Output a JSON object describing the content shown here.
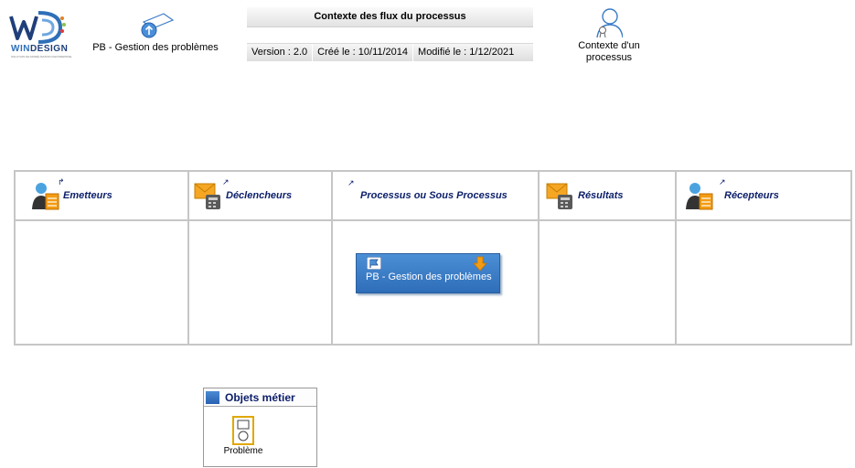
{
  "logo": {
    "brand_win": "WIN",
    "brand_design": "DESIGN",
    "tagline": "SOLUTION DE MODÉLISATION D'ENTREPRISE"
  },
  "parent": {
    "label": "PB - Gestion des problèmes",
    "icon": "process-up-icon"
  },
  "header": {
    "title": "Contexte des flux du processus",
    "version": "Version : 2.0",
    "created": "Créé le : 10/11/2014",
    "modified": "Modifié le : 1/12/2021"
  },
  "context": {
    "label_line1": "Contexte d'un",
    "label_line2": "processus",
    "icon": "person-certificate-icon"
  },
  "columns": {
    "emetteurs": "Emetteurs",
    "declencheurs": "Déclencheurs",
    "processus": "Processus ou Sous Processus",
    "resultats": "Résultats",
    "recepteurs": "Récepteurs"
  },
  "process_box": {
    "label": "PB - Gestion des problèmes",
    "color": "#3a7cc6"
  },
  "objets": {
    "title": "Objets métier",
    "items": [
      {
        "label": "Problème",
        "icon": "business-object-icon"
      }
    ]
  },
  "colors": {
    "accent": "#0b1e6a",
    "grid": "#c6c6c6",
    "process": "#3a7cc6"
  }
}
